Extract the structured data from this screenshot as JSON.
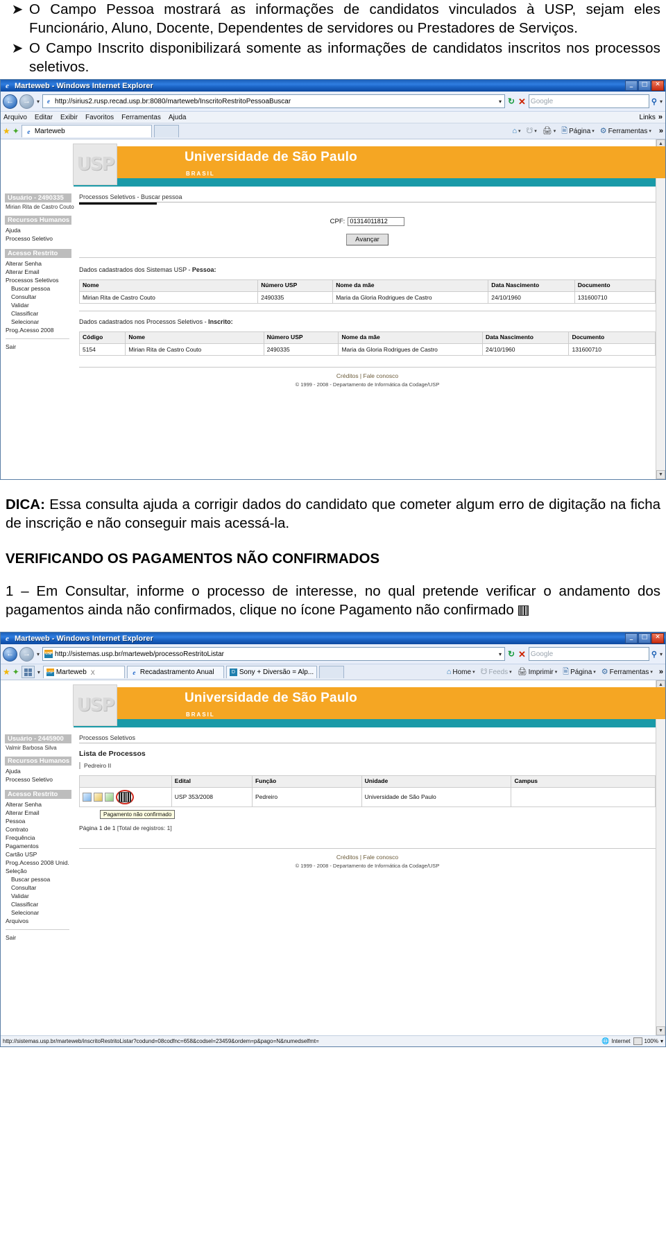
{
  "doc": {
    "bullets": [
      {
        "marker": "➤",
        "text": "O Campo Pessoa mostrará as informações de candidatos vinculados à USP, sejam eles Funcionário, Aluno, Docente, Dependentes de servidores ou Prestadores de Serviços."
      },
      {
        "marker": "➤",
        "text": "O Campo Inscrito disponibilizará somente as informações de candidatos inscritos nos processos seletivos."
      }
    ],
    "dica_label": "DICA:",
    "dica_text": " Essa consulta ajuda a corrigir dados do candidato que cometer algum erro de digitação na ficha de inscrição e não conseguir mais acessá-la.",
    "section_heading": "VERIFICANDO OS PAGAMENTOS NÃO CONFIRMADOS",
    "step_text": "1 – Em Consultar, informe o processo de interesse, no qual pretende verificar o andamento dos pagamentos ainda não confirmados, clique no ícone Pagamento não confirmado",
    "step_icon_name": "barcode-icon"
  },
  "window1": {
    "title": "Marteweb - Windows Internet Explorer",
    "window_buttons": {
      "minimize": "_",
      "maximize": "□",
      "close": "✕"
    },
    "nav": {
      "back": "←",
      "forward": "→",
      "history_caret": "▾"
    },
    "address": {
      "url": "http://sirius2.rusp.recad.usp.br:8080/marteweb/InscritoRestritoPessoaBuscar",
      "dropdown_caret": "▾",
      "refresh": "↻",
      "stop": "✕"
    },
    "search": {
      "placeholder": "Google",
      "icon": "search-icon",
      "caret": "▾"
    },
    "menu": [
      "Arquivo",
      "Editar",
      "Exibir",
      "Favoritos",
      "Ferramentas",
      "Ajuda"
    ],
    "menu_right": {
      "links": "Links",
      "chevron": "»"
    },
    "tabs": [
      {
        "label": "Marteweb",
        "icon": "ie-icon",
        "active": true
      },
      {
        "label": "",
        "icon": "blank",
        "active": false
      }
    ],
    "commands": [
      {
        "label": "",
        "icon": "home-icon",
        "caret": "▾"
      },
      {
        "label": "",
        "icon": "feeds-icon",
        "caret": "▾"
      },
      {
        "label": "",
        "icon": "print-icon",
        "caret": "▾"
      },
      {
        "label": "Página",
        "icon": "page-icon",
        "caret": "▾"
      },
      {
        "label": "Ferramentas",
        "icon": "gear-icon",
        "caret": "▾"
      }
    ],
    "banner": {
      "logo": "USP",
      "title": "Universidade de São Paulo",
      "subtitle": "BRASIL"
    },
    "sidebar": {
      "user_header": "Usuário - 2490335",
      "user_name": "Mirian Rita de Castro Couto",
      "groups": [
        {
          "header": "Recursos Humanos",
          "items": [
            {
              "label": "Ajuda",
              "indent": false
            },
            {
              "label": "Processo Seletivo",
              "indent": false
            }
          ]
        },
        {
          "header": "Acesso Restrito",
          "items": [
            {
              "label": "Alterar Senha",
              "indent": false
            },
            {
              "label": "Alterar Email",
              "indent": false
            },
            {
              "label": "Processos Seletivos",
              "indent": false
            },
            {
              "label": "Buscar pessoa",
              "indent": true
            },
            {
              "label": "Consultar",
              "indent": true
            },
            {
              "label": "Validar",
              "indent": true
            },
            {
              "label": "Classificar",
              "indent": true
            },
            {
              "label": "Selecionar",
              "indent": true
            },
            {
              "label": "Prog.Acesso 2008",
              "indent": false
            }
          ]
        }
      ],
      "exit": "Sair"
    },
    "main": {
      "breadcrumb": "Processos Seletivos - Buscar pessoa",
      "cpf_label": "CPF:",
      "cpf_value": "01314011812",
      "submit_label": "Avançar",
      "table1_caption_prefix": "Dados cadastrados dos Sistemas USP - ",
      "table1_caption_bold": "Pessoa:",
      "table1_headers": [
        "Nome",
        "Número USP",
        "Nome da mãe",
        "Data Nascimento",
        "Documento"
      ],
      "table1_rows": [
        [
          "Mirian Rita de Castro Couto",
          "2490335",
          "Maria da Gloria Rodrigues de Castro",
          "24/10/1960",
          "131600710"
        ]
      ],
      "table2_caption_prefix": "Dados cadastrados nos Processos Seletivos - ",
      "table2_caption_bold": "Inscrito:",
      "table2_headers": [
        "Código",
        "Nome",
        "Número USP",
        "Nome da mãe",
        "Data Nascimento",
        "Documento"
      ],
      "table2_rows": [
        [
          "5154",
          "Mirian Rita de Castro Couto",
          "2490335",
          "Maria da Gloria Rodrigues de Castro",
          "24/10/1960",
          "131600710"
        ]
      ]
    },
    "footer": {
      "links": "Créditos | Fale conosco",
      "copyright": "© 1999 - 2008 - Departamento de Informática da Codage/USP"
    }
  },
  "window2": {
    "title": "Marteweb - Windows Internet Explorer",
    "window_buttons": {
      "minimize": "_",
      "maximize": "□",
      "close": "✕"
    },
    "nav": {
      "back": "←",
      "forward": "→",
      "history_caret": "▾"
    },
    "address": {
      "url": "http://sistemas.usp.br/marteweb/processoRestritoListar",
      "dropdown_caret": "▾",
      "refresh": "↻",
      "stop": "✕"
    },
    "search": {
      "placeholder": "Google",
      "icon": "search-icon",
      "caret": "▾"
    },
    "tabs": [
      {
        "label": "Marteweb",
        "icon": "usp-icon",
        "active": true,
        "close": "X"
      },
      {
        "label": "Recadastramento Anual",
        "icon": "ie-icon",
        "active": false
      },
      {
        "label": "Sony + Diversão = Alp...",
        "icon": "sony-icon",
        "active": false
      },
      {
        "label": "",
        "icon": "blank",
        "active": false
      }
    ],
    "commands": [
      {
        "label": "Home",
        "icon": "home-icon",
        "caret": "▾"
      },
      {
        "label": "Feeds",
        "icon": "feeds-icon",
        "caret": "▾"
      },
      {
        "label": "Imprimir",
        "icon": "print-icon",
        "caret": "▾"
      },
      {
        "label": "Página",
        "icon": "page-icon",
        "caret": "▾"
      },
      {
        "label": "Ferramentas",
        "icon": "gear-icon",
        "caret": "▾"
      }
    ],
    "banner": {
      "logo": "USP",
      "title": "Universidade de São Paulo",
      "subtitle": "BRASIL"
    },
    "sidebar": {
      "user_header": "Usuário - 2445900",
      "user_name": "Valmir Barbosa Silva",
      "groups": [
        {
          "header": "Recursos Humanos",
          "items": [
            {
              "label": "Ajuda",
              "indent": false
            },
            {
              "label": "Processo Seletivo",
              "indent": false
            }
          ]
        },
        {
          "header": "Acesso Restrito",
          "items": [
            {
              "label": "Alterar Senha",
              "indent": false
            },
            {
              "label": "Alterar Email",
              "indent": false
            },
            {
              "label": "Pessoa",
              "indent": false
            },
            {
              "label": "Contrato",
              "indent": false
            },
            {
              "label": "Frequência",
              "indent": false
            },
            {
              "label": "Pagamentos",
              "indent": false
            },
            {
              "label": "Cartão USP",
              "indent": false
            },
            {
              "label": "Prog.Acesso 2008 Unid.",
              "indent": false
            },
            {
              "label": "Seleção",
              "indent": false
            },
            {
              "label": "Buscar pessoa",
              "indent": true
            },
            {
              "label": "Consultar",
              "indent": true
            },
            {
              "label": "Validar",
              "indent": true
            },
            {
              "label": "Classificar",
              "indent": true
            },
            {
              "label": "Selecionar",
              "indent": true
            },
            {
              "label": "Arquivos",
              "indent": false
            }
          ]
        }
      ],
      "exit": "Sair"
    },
    "main": {
      "breadcrumb": "Processos Seletivos",
      "list_title": "Lista de Processos",
      "process_name": "Pedreiro II",
      "table_headers": [
        "",
        "Edital",
        "Função",
        "Unidade",
        "Campus"
      ],
      "table_rows": [
        {
          "icons": [
            "copy-icon",
            "edit-icon",
            "doc-icon",
            "barcode-icon"
          ],
          "edital": "USP 353/2008",
          "funcao": "Pedreiro",
          "unidade": "Universidade de São Paulo",
          "campus": ""
        }
      ],
      "tooltip": "Pagamento não confirmado",
      "pagination": "Página 1 de 1",
      "total": "[Total de registros: 1]"
    },
    "footer": {
      "links": "Créditos | Fale conosco",
      "copyright": "© 1999 - 2008 - Departamento de Informática da Codage/USP"
    },
    "statusbar": {
      "url": "http://sistemas.usp.br/marteweb/inscritoRestritoListar?codund=08codfnc=658&codsel=23459&ordem=p&pago=N&numedselfmt=",
      "zone": "Internet",
      "zoom": "100%",
      "zoom_caret": "▾"
    }
  }
}
